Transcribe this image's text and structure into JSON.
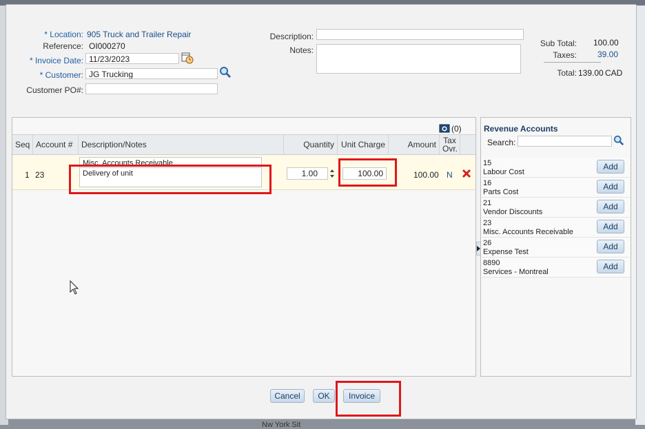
{
  "header": {
    "location_label": "* Location:",
    "location_value": "905 Truck and Trailer Repair",
    "reference_label": "Reference:",
    "reference_value": "OI000270",
    "invoice_date_label": "* Invoice Date:",
    "invoice_date_value": "11/23/2023",
    "customer_label": "* Customer:",
    "customer_value": "JG Trucking",
    "customer_po_label": "Customer PO#:",
    "customer_po_value": "",
    "description_label": "Description:",
    "description_value": "",
    "notes_label": "Notes:",
    "notes_value": ""
  },
  "totals": {
    "subtotal_label": "Sub Total:",
    "subtotal_value": "100.00",
    "taxes_label": "Taxes:",
    "taxes_value": "39.00",
    "total_label": "Total:",
    "total_value": "139.00",
    "currency": "CAD"
  },
  "grid": {
    "attachments_count": "(0)",
    "columns": {
      "seq": "Seq",
      "account": "Account #",
      "description": "Description/Notes",
      "quantity": "Quantity",
      "unit_charge": "Unit Charge",
      "amount": "Amount",
      "tax_ovr_line1": "Tax",
      "tax_ovr_line2": "Ovr."
    },
    "rows": [
      {
        "seq": "1",
        "account": "23",
        "description": "Misc. Accounts Receivable",
        "notes": "Delivery of unit",
        "quantity": "1.00",
        "unit_charge": "100.00",
        "amount": "100.00",
        "tax_ovr": "N"
      }
    ]
  },
  "revenue": {
    "title": "Revenue Accounts",
    "search_label": "Search:",
    "search_value": "",
    "add_label": "Add",
    "items": [
      {
        "code": "15",
        "name": "Labour Cost"
      },
      {
        "code": "16",
        "name": "Parts Cost"
      },
      {
        "code": "21",
        "name": "Vendor Discounts"
      },
      {
        "code": "23",
        "name": "Misc. Accounts Receivable"
      },
      {
        "code": "26",
        "name": "Expense Test"
      },
      {
        "code": "8890",
        "name": "Services - Montreal"
      }
    ]
  },
  "footer": {
    "cancel_label": "Cancel",
    "ok_label": "OK",
    "invoice_label": "Invoice"
  },
  "background": {
    "bottom_text": "Nw York Sit"
  },
  "colors": {
    "accent": "#1a4f8b",
    "highlight_box": "#e0161b",
    "row_background": "#fffbe6"
  }
}
